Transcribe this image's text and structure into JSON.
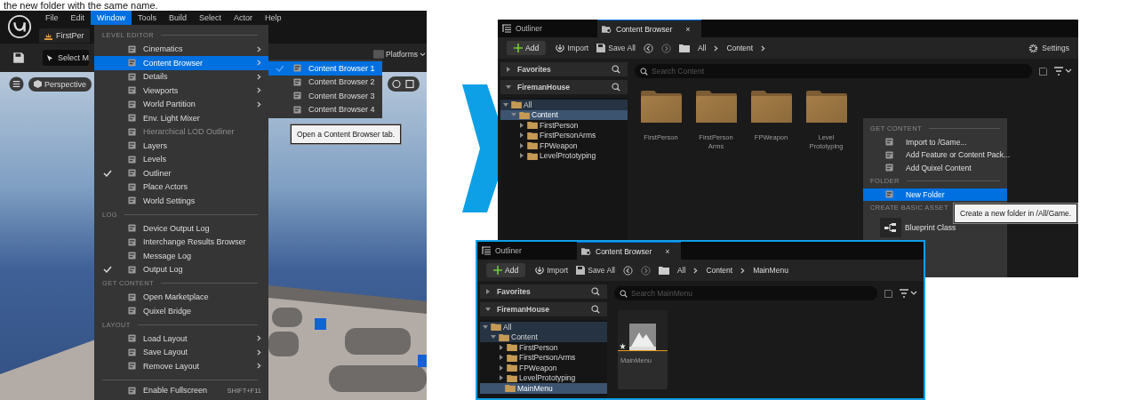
{
  "caption": "the new folder with the same name.",
  "editor": {
    "menu_bar": [
      {
        "label": "File",
        "selected": false
      },
      {
        "label": "Edit",
        "selected": false
      },
      {
        "label": "Window",
        "selected": true
      },
      {
        "label": "Tools",
        "selected": false
      },
      {
        "label": "Build",
        "selected": false
      },
      {
        "label": "Select",
        "selected": false
      },
      {
        "label": "Actor",
        "selected": false
      },
      {
        "label": "Help",
        "selected": false
      }
    ],
    "level_tab": "FirstPer",
    "mode_button": "Select M",
    "platforms_button": "Platforms",
    "view_mode_button": "Perspective",
    "window_menu": {
      "sections": [
        {
          "header": "LEVEL EDITOR",
          "items": [
            {
              "label": "Cinematics",
              "checked": false,
              "disabled": false,
              "selected": false,
              "submenu": true
            },
            {
              "label": "Content Browser",
              "checked": false,
              "disabled": false,
              "selected": true,
              "submenu": true
            },
            {
              "label": "Details",
              "checked": false,
              "disabled": false,
              "selected": false,
              "submenu": true
            },
            {
              "label": "Viewports",
              "checked": false,
              "disabled": false,
              "selected": false,
              "submenu": true
            },
            {
              "label": "World Partition",
              "checked": false,
              "disabled": false,
              "selected": false,
              "submenu": true
            },
            {
              "label": "Env. Light Mixer",
              "checked": false,
              "disabled": false,
              "selected": false,
              "submenu": false
            },
            {
              "label": "Hierarchical LOD Outliner",
              "checked": false,
              "disabled": true,
              "selected": false,
              "submenu": false
            },
            {
              "label": "Layers",
              "checked": false,
              "disabled": false,
              "selected": false,
              "submenu": false
            },
            {
              "label": "Levels",
              "checked": false,
              "disabled": false,
              "selected": false,
              "submenu": false
            },
            {
              "label": "Outliner",
              "checked": true,
              "disabled": false,
              "selected": false,
              "submenu": false
            },
            {
              "label": "Place Actors",
              "checked": false,
              "disabled": false,
              "selected": false,
              "submenu": false
            },
            {
              "label": "World Settings",
              "checked": false,
              "disabled": false,
              "selected": false,
              "submenu": false
            }
          ]
        },
        {
          "header": "LOG",
          "items": [
            {
              "label": "Device Output Log",
              "checked": false,
              "disabled": false,
              "selected": false,
              "submenu": false
            },
            {
              "label": "Interchange Results Browser",
              "checked": false,
              "disabled": false,
              "selected": false,
              "submenu": false
            },
            {
              "label": "Message Log",
              "checked": false,
              "disabled": false,
              "selected": false,
              "submenu": false
            },
            {
              "label": "Output Log",
              "checked": true,
              "disabled": false,
              "selected": false,
              "submenu": false
            }
          ]
        },
        {
          "header": "GET CONTENT",
          "items": [
            {
              "label": "Open Marketplace",
              "checked": false,
              "disabled": false,
              "selected": false,
              "submenu": false
            },
            {
              "label": "Quixel Bridge",
              "checked": false,
              "disabled": false,
              "selected": false,
              "submenu": false
            }
          ]
        },
        {
          "header": "LAYOUT",
          "items": [
            {
              "label": "Load Layout",
              "checked": false,
              "disabled": false,
              "selected": false,
              "submenu": true
            },
            {
              "label": "Save Layout",
              "checked": false,
              "disabled": false,
              "selected": false,
              "submenu": true
            },
            {
              "label": "Remove Layout",
              "checked": false,
              "disabled": false,
              "selected": false,
              "submenu": true
            }
          ]
        },
        {
          "items": [
            {
              "label": "Enable Fullscreen",
              "checked": false,
              "disabled": false,
              "selected": false,
              "submenu": false,
              "shortcut": "SHIFT+F11"
            }
          ]
        }
      ]
    },
    "submenu": {
      "items": [
        {
          "label": "Content Browser 1",
          "selected": true,
          "checked": true
        },
        {
          "label": "Content Browser 2",
          "selected": false,
          "checked": false
        },
        {
          "label": "Content Browser 3",
          "selected": false,
          "checked": false
        },
        {
          "label": "Content Browser 4",
          "selected": false,
          "checked": false
        }
      ]
    },
    "tooltip": "Open a Content Browser tab."
  },
  "top_browser": {
    "tabs": [
      {
        "kind": "outliner",
        "label": "Outliner",
        "selected": false
      },
      {
        "kind": "content_browser",
        "label": "Content Browser",
        "selected": true,
        "close": "×"
      }
    ],
    "add_button": "Add",
    "import_button": "Import",
    "save_all_button": "Save All",
    "breadcrumb": [
      {
        "label": "All",
        "chevron": true
      },
      {
        "label": "Content",
        "chevron": true
      }
    ],
    "settings_button": "Settings",
    "favorites": {
      "label": "Favorites",
      "expanded": false
    },
    "project": {
      "label": "FiremanHouse",
      "expanded": true
    },
    "tree": [
      {
        "label": "All",
        "expandable": true,
        "expanded": true,
        "selected": false,
        "children": [
          {
            "label": "Content",
            "expandable": true,
            "expanded": true,
            "selected": true,
            "children": [
              {
                "label": "FirstPerson",
                "expandable": true,
                "expanded": false,
                "selected": false
              },
              {
                "label": "FirstPersonArms",
                "expandable": true,
                "expanded": false,
                "selected": false
              },
              {
                "label": "FPWeapon",
                "expandable": true,
                "expanded": false,
                "selected": false
              },
              {
                "label": "LevelPrototyping",
                "expandable": true,
                "expanded": false,
                "selected": false
              }
            ]
          }
        ]
      }
    ],
    "search_placeholder": "Search Content",
    "items": [
      {
        "kind": "folder",
        "label": "FirstPerson"
      },
      {
        "kind": "folder",
        "label": "FirstPerson Arms"
      },
      {
        "kind": "folder",
        "label": "FPWeapon"
      },
      {
        "kind": "folder",
        "label": "Level Prototyping"
      }
    ],
    "context_menu": {
      "sections": [
        {
          "header": "GET CONTENT",
          "items": [
            {
              "kind": "command",
              "label": "Import to /Game...",
              "selected": false
            },
            {
              "kind": "command",
              "label": "Add Feature or Content Pack...",
              "selected": false
            },
            {
              "kind": "command",
              "label": "Add Quixel Content",
              "selected": false
            }
          ]
        },
        {
          "header": "FOLDER",
          "items": [
            {
              "kind": "command",
              "label": "New Folder",
              "selected": true
            }
          ]
        },
        {
          "header": "CREATE BASIC ASSET",
          "items": [
            {
              "kind": "asset",
              "label": "Blueprint Class",
              "selected": false
            }
          ]
        }
      ]
    },
    "tooltip": "Create a new folder in /All/Game."
  },
  "bottom_browser": {
    "tabs": [
      {
        "kind": "outliner",
        "label": "Outliner",
        "selected": false
      },
      {
        "kind": "content_browser",
        "label": "Content Browser",
        "selected": true,
        "close": "×"
      }
    ],
    "add_button": "Add",
    "import_button": "Import",
    "save_all_button": "Save All",
    "breadcrumb": [
      {
        "label": "All",
        "chevron": true
      },
      {
        "label": "Content",
        "chevron": true
      },
      {
        "label": "MainMenu",
        "chevron": false
      }
    ],
    "favorites": {
      "label": "Favorites",
      "expanded": false
    },
    "project": {
      "label": "FiremanHouse",
      "expanded": true
    },
    "tree": [
      {
        "label": "All",
        "expandable": true,
        "expanded": true,
        "selected": false,
        "children": [
          {
            "label": "Content",
            "expandable": true,
            "expanded": true,
            "selected": false,
            "children": [
              {
                "label": "FirstPerson",
                "expandable": true,
                "expanded": false,
                "selected": false
              },
              {
                "label": "FirstPersonArms",
                "expandable": true,
                "expanded": false,
                "selected": false
              },
              {
                "label": "FPWeapon",
                "expandable": true,
                "expanded": false,
                "selected": false
              },
              {
                "label": "LevelPrototyping",
                "expandable": true,
                "expanded": false,
                "selected": false
              },
              {
                "label": "MainMenu",
                "expandable": false,
                "expanded": false,
                "selected": true
              }
            ]
          }
        ]
      }
    ],
    "search_placeholder": "Search MainMenu",
    "items": [
      {
        "kind": "level",
        "label": "MainMenu"
      }
    ]
  }
}
